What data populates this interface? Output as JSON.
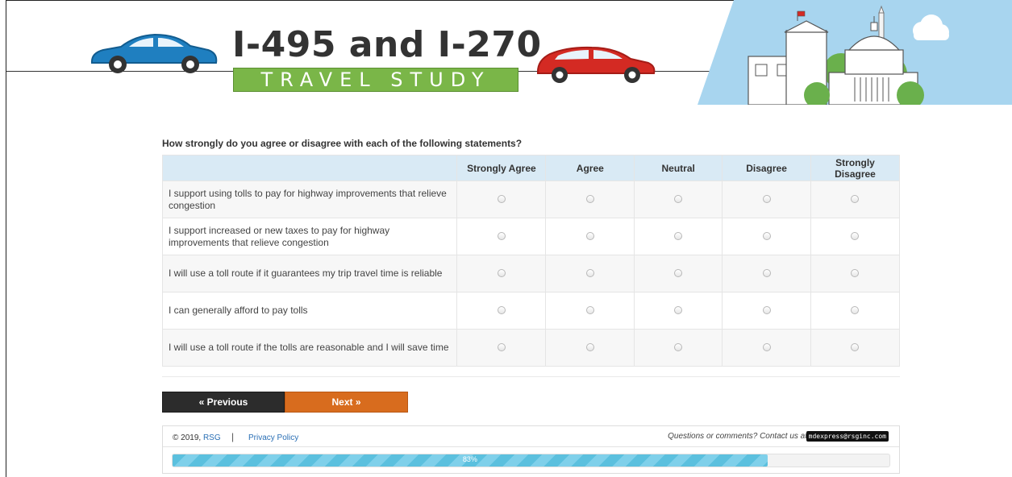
{
  "header": {
    "title": "I-495 and I-270",
    "subtitle": "TRAVEL STUDY"
  },
  "question": "How strongly do you agree or disagree with each of the following statements?",
  "columns": [
    "Strongly Agree",
    "Agree",
    "Neutral",
    "Disagree",
    "Strongly Disagree"
  ],
  "statements": [
    "I support using tolls to pay for highway improvements that relieve congestion",
    "I support increased or new taxes to pay for highway improvements that relieve congestion",
    "I will use a toll route if it guarantees my trip travel time is reliable",
    "I can generally afford to pay tolls",
    "I will use a toll route if the tolls are reasonable and I will save time"
  ],
  "buttons": {
    "previous": "« Previous",
    "next": "Next »"
  },
  "footer": {
    "copyright": "© 2019,",
    "company": "RSG",
    "privacy": "Privacy Policy",
    "contact": "Questions or comments? Contact us at",
    "email": "mdexpress@rsginc.com"
  },
  "progress": {
    "percent": 83,
    "label": "83%"
  },
  "colors": {
    "header_row": "#d9eaf5",
    "next_button": "#d86c1e",
    "previous_button": "#2c2c2c",
    "progress": "#5bc0de",
    "subtitle_bg": "#7ab648"
  }
}
